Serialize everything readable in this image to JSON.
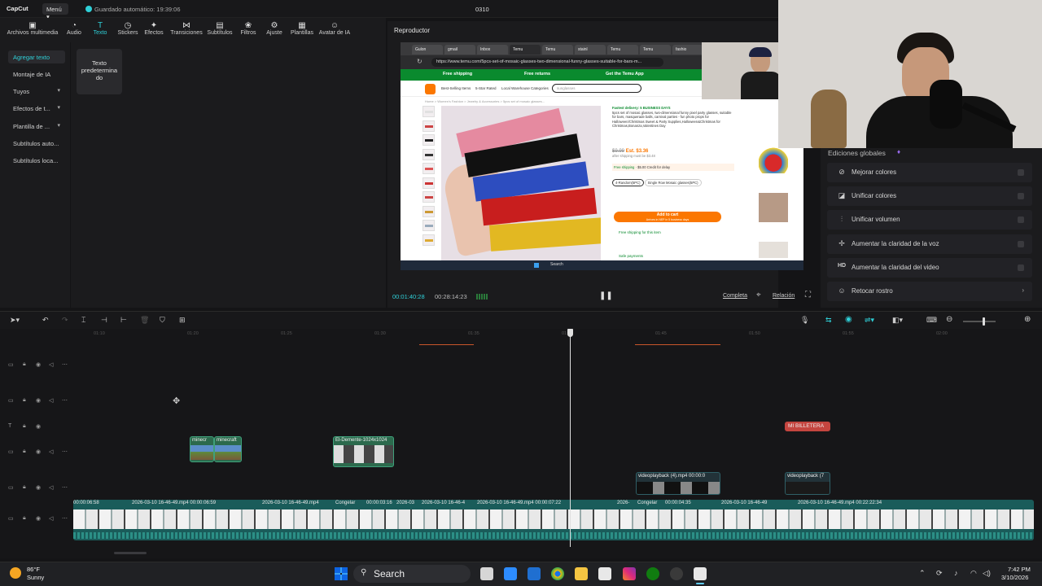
{
  "app": {
    "logo": "CapCut",
    "menu_label": "Menú",
    "autosave": "Guardado automático: 19:39:06",
    "project_name": "0310"
  },
  "toolbar": {
    "items": [
      {
        "label": "Archivos multimedia",
        "icon": "media-icon"
      },
      {
        "label": "Audio",
        "icon": "audio-icon"
      },
      {
        "label": "Texto",
        "icon": "text-icon"
      },
      {
        "label": "Stickers",
        "icon": "sticker-icon"
      },
      {
        "label": "Efectos",
        "icon": "effects-icon"
      },
      {
        "label": "Transiciones",
        "icon": "transitions-icon"
      },
      {
        "label": "Subtítulos",
        "icon": "subtitles-icon"
      },
      {
        "label": "Filtros",
        "icon": "filters-icon"
      },
      {
        "label": "Ajuste",
        "icon": "adjust-icon"
      },
      {
        "label": "Plantillas",
        "icon": "templates-icon"
      },
      {
        "label": "Avatar de IA",
        "icon": "ai-avatar-icon"
      }
    ]
  },
  "leftnav": {
    "items": [
      {
        "label": "Agregar texto"
      },
      {
        "label": "Montaje de IA"
      },
      {
        "label": "Tuyos"
      },
      {
        "label": "Efectos de t..."
      },
      {
        "label": "Plantilla de ..."
      },
      {
        "label": "Subtítulos auto..."
      },
      {
        "label": "Subtítulos loca..."
      }
    ]
  },
  "assets": {
    "default_text_l1": "Texto",
    "default_text_l2": "predetermina",
    "default_text_l3": "do"
  },
  "player": {
    "title": "Reproductor",
    "current_time": "00:01:40:28",
    "total_time": "00:28:14:23",
    "full_label": "Completa",
    "ratio_label": "Relación"
  },
  "browser": {
    "tabs": [
      "Gulon",
      "gmail",
      "Inbox",
      "Temu",
      "Temu",
      "stainl",
      "Temu",
      "Temu",
      "fashio"
    ],
    "url": "https://www.temu.com/5pcs-set-of-mosaic-glasses-two-dimensional-funny-glasses-suitable-for-bars-m...",
    "banner": [
      "Free shipping",
      "Free returns",
      "Get the Temu App"
    ],
    "nav": [
      "Best-Selling Items",
      "5-Star Rated",
      "Local Warehouse",
      "Categories"
    ],
    "search_placeholder": "sunglasses",
    "breadcrumb": "Home > Women's Fashion > Jewelry & Accessories > 5pcs set of mosaic glasses...",
    "delivery": "Fastest delivery: 5 BUSINESS DAYS",
    "product_title": "5pcs set of mosaic glasses, two-dimensional funny pixel party glasses, suitable for bars, masquerade balls, carnival parties - fun photo props for Halloween/Christmas Sweet & Party Supplies,Halloween&Christmas for Christmas,Bonanza,Valentines Day",
    "old_price": "$9.99",
    "est_price": "Est. $3.36",
    "price_note": "after shipping must be $3.48",
    "shipping_tag": "Free shipping",
    "credit_tag": "$5.00 Credit for delay",
    "options": [
      "4-Random(5PC)",
      "Single Row Mosaic glasses(5PC)"
    ],
    "cart_button": "Add to cart",
    "cart_sub": "Arrives in NEP in 5 business days",
    "free_ship_line": "Free shipping for this item",
    "safe_line": "Safe payments",
    "taskbar_search": "Search"
  },
  "right_panel": {
    "title": "Ediciones globales",
    "items": [
      {
        "label": "Mejorar colores",
        "icon": "color-enhance-icon"
      },
      {
        "label": "Unificar colores",
        "icon": "color-unify-icon"
      },
      {
        "label": "Unificar volumen",
        "icon": "volume-unify-icon"
      },
      {
        "label": "Aumentar la claridad de la voz",
        "icon": "voice-clarity-icon"
      },
      {
        "label": "Aumentar la claridad del video",
        "icon": "hd-icon"
      },
      {
        "label": "Retocar rostro",
        "icon": "face-retouch-icon"
      }
    ]
  },
  "timeline": {
    "ruler": [
      "01:10",
      "01:20",
      "01:25",
      "01:30",
      "01:35",
      "01:40",
      "01:45",
      "01:50",
      "01:55",
      "02:00"
    ],
    "clips": {
      "minecraft_a": "minecr",
      "minecraft_b": "minecraft",
      "el_demente": "El-Demente-1024x1024",
      "videoplayback_a": "videoplayback (4).mp4 00:00:0",
      "videoplayback_b": "videoplayback (7",
      "text_clip": "MI BILLETERA"
    },
    "main_labels": [
      "00:00:06:58",
      "2026-03-10 16-46-49.mp4 00:00:06:59",
      "2026-03-10 16-46-49.mp4",
      "Congelar",
      "00:00:03:16",
      "2026-03",
      "2026-03-10 16-46-4",
      "2026-03-10 16-46-49.mp4 00:00:07:22",
      "2026-",
      "Congelar",
      "00:00:04:35",
      "2026-03-10 16-46-49",
      "2026-03-10 16-46-49.mp4 00:22:22:34"
    ]
  },
  "taskbar": {
    "weather_temp": "86°F",
    "weather_desc": "Sunny",
    "search": "Search",
    "time": "7:42 PM",
    "date": "3/10/2026"
  },
  "colors": {
    "accent": "#2fd0d8",
    "clip_teal": "#1f8f8a",
    "text_clip": "#c4453f",
    "cart_orange": "#fb7701"
  }
}
